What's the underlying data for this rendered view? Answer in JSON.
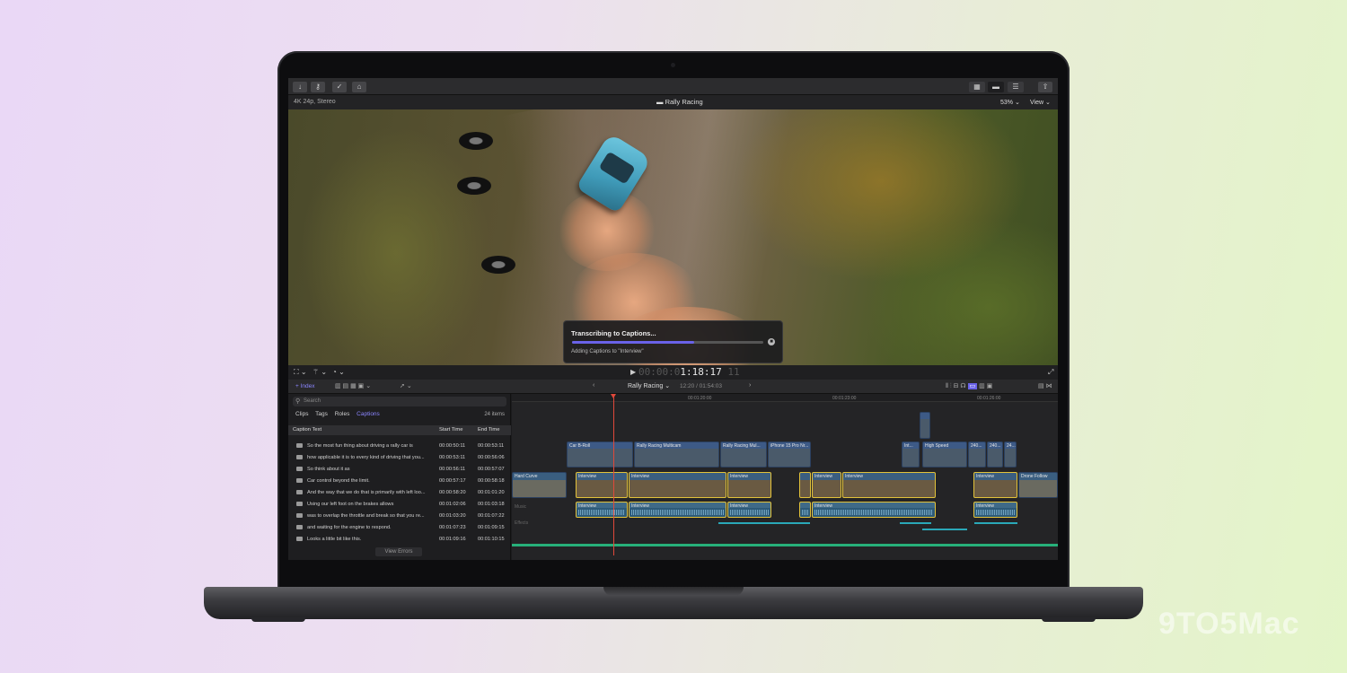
{
  "toolbar": {
    "import_icon": "↓",
    "key_icon": "⚷",
    "check_icon": "✓",
    "tag_icon": "⌂"
  },
  "viewer": {
    "format": "4K 24p, Stereo",
    "project_title": "Rally Racing",
    "zoom": "53%",
    "view_menu": "View"
  },
  "dialog": {
    "title": "Transcribing to Captions...",
    "progress": 0.64,
    "subtitle": "Adding Captions to \"Interview\""
  },
  "transport": {
    "timecode_dim": "00:00:0",
    "timecode_lit": "1:18:17",
    "timecode_tail": "11"
  },
  "timeline_header": {
    "index_label": "Index",
    "project": "Rally Racing",
    "duration": "12:20 / 01:54:03",
    "ruler": [
      "00:01:20:00",
      "00:01:23:00",
      "00:01:26:00"
    ]
  },
  "index": {
    "search_placeholder": "Search",
    "tabs": [
      "Clips",
      "Tags",
      "Roles",
      "Captions"
    ],
    "active_tab": "Captions",
    "count": "24 items",
    "columns": {
      "text": "Caption Text",
      "start": "Start Time",
      "end": "End Time"
    },
    "rows": [
      {
        "text": "So the most fun thing about driving a rally car is",
        "start": "00:00:50:11",
        "end": "00:00:53:11"
      },
      {
        "text": "how applicable it is to every kind of driving that you...",
        "start": "00:00:53:11",
        "end": "00:00:56:06"
      },
      {
        "text": "So think about it as",
        "start": "00:00:56:11",
        "end": "00:00:57:07"
      },
      {
        "text": "Car control beyond the limit.",
        "start": "00:00:57:17",
        "end": "00:00:58:18"
      },
      {
        "text": "And the way that we do that is primarily with left loo...",
        "start": "00:00:58:20",
        "end": "00:01:01:20"
      },
      {
        "text": "Using our left foot on the brakes allows",
        "start": "00:01:02:06",
        "end": "00:01:03:18"
      },
      {
        "text": "was to overlap the throttle and break so that you re...",
        "start": "00:01:03:20",
        "end": "00:01:07:22"
      },
      {
        "text": "and waiting for the engine to respond.",
        "start": "00:01:07:23",
        "end": "00:01:09:15"
      },
      {
        "text": "Looks a little bit like this.",
        "start": "00:01:09:16",
        "end": "00:01:10:15"
      }
    ],
    "view_errors": "View Errors"
  },
  "timeline": {
    "broll": [
      "Car B-Roll",
      "Rally Racing Multicam",
      "Rally Racing Mul...",
      "iPhone 15 Pro Nr...",
      "Int...",
      "High Speed",
      "240...",
      "240...",
      "24..."
    ],
    "story": [
      "Hard Curve",
      "Interview",
      "Interview",
      "Interview",
      "Interview",
      "Interview",
      "Interview",
      "Drone Follow"
    ],
    "audio": [
      "Interview",
      "Interview",
      "Interview",
      "Interview",
      "Interview"
    ]
  },
  "watermark": "9TO5Mac",
  "colors": {
    "accent": "#6a62e8",
    "playhead": "#e0483a",
    "selection": "#e2c23a"
  }
}
